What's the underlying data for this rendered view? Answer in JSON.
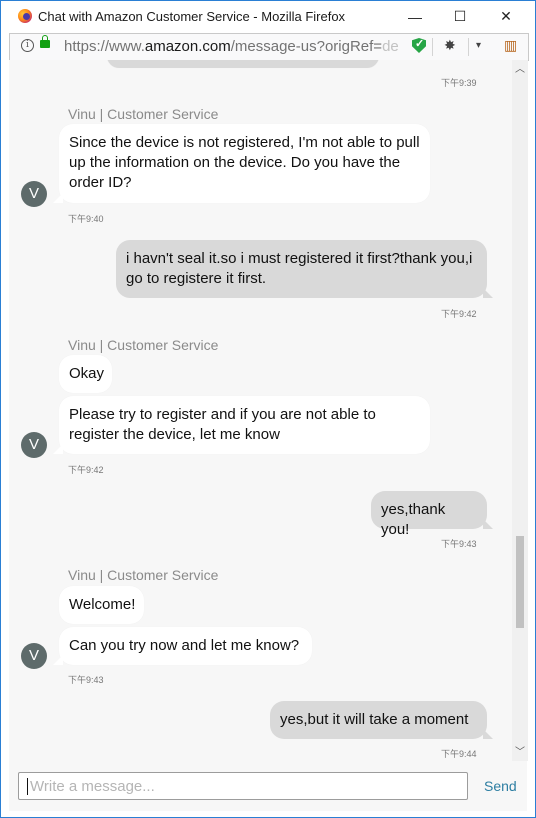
{
  "window": {
    "title": "Chat with Amazon Customer Service - Mozilla Firefox",
    "controls": {
      "minimize": "—",
      "maximize": "☐",
      "close": "✕"
    }
  },
  "urlbar": {
    "scheme": "https://www.",
    "host": "amazon.com",
    "path": "/message-us?origRef=",
    "fade": "de"
  },
  "chat": {
    "top_timestamp": "下午9:39",
    "agent_name": "Vinu | Customer Service",
    "avatar_letter": "V",
    "groups": [
      {
        "agent_label": "Vinu | Customer Service",
        "messages": [
          "Since the device is not registered, I'm not able to pull up the information on the device. Do you have the order ID?"
        ],
        "timestamp": "下午9:40"
      },
      {
        "user_message": "i havn't seal it.so i must registered it first?thank you,i go to registere it first.",
        "timestamp": "下午9:42"
      },
      {
        "agent_label": "Vinu | Customer Service",
        "messages": [
          "Okay",
          "Please try to register and if you are not able to register the device, let me know"
        ],
        "timestamp": "下午9:42"
      },
      {
        "user_message": "yes,thank you!",
        "timestamp": "下午9:43"
      },
      {
        "agent_label": "Vinu | Customer Service",
        "messages": [
          "Welcome!",
          "Can you try now and let me know?"
        ],
        "timestamp": "下午9:43"
      },
      {
        "user_message": "yes,but it will take a moment",
        "timestamp": "下午9:44"
      }
    ]
  },
  "composer": {
    "placeholder": "Write a message...",
    "send_label": "Send"
  }
}
